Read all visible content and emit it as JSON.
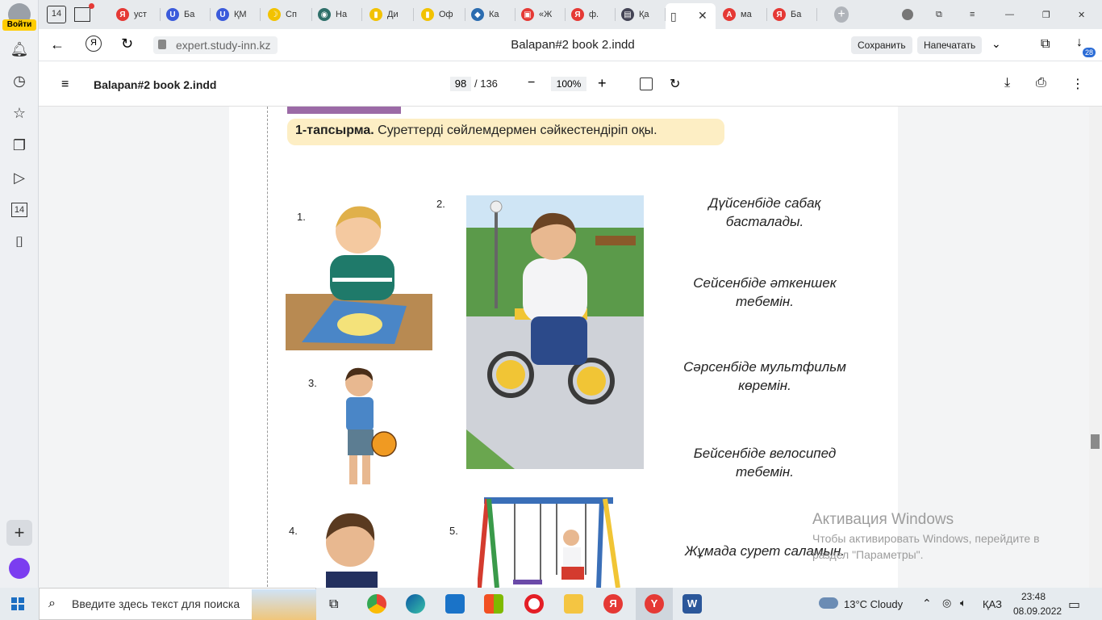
{
  "sidebar": {
    "login_label": "Войти",
    "badge_number": "14"
  },
  "tabs": [
    {
      "label": "уст",
      "color": "#e53935",
      "glyph": "Я"
    },
    {
      "label": "Ба",
      "color": "#3b5bdb",
      "glyph": "U"
    },
    {
      "label": "ҚМ",
      "color": "#3b5bdb",
      "glyph": "U"
    },
    {
      "label": "Сп",
      "color": "#f2c200",
      "glyph": "☽"
    },
    {
      "label": "На",
      "color": "#2f6f6a",
      "glyph": "◉"
    },
    {
      "label": "Ди",
      "color": "#f2c200",
      "glyph": "▮"
    },
    {
      "label": "Оф",
      "color": "#f2c200",
      "glyph": "▮"
    },
    {
      "label": "Ка",
      "color": "#2b6cb0",
      "glyph": "◆"
    },
    {
      "label": "«Ж",
      "color": "#e53935",
      "glyph": "▣"
    },
    {
      "label": "ф.",
      "color": "#e53935",
      "glyph": "Я"
    },
    {
      "label": "Қа",
      "color": "#445",
      "glyph": "▤"
    },
    {
      "label": "",
      "color": "#666",
      "glyph": "▯"
    },
    {
      "label": "ма",
      "color": "#e53935",
      "glyph": "A"
    },
    {
      "label": "Ба",
      "color": "#e53935",
      "glyph": "Я"
    }
  ],
  "address": {
    "url": "expert.study-inn.kz",
    "page_title": "Balapan#2 book 2.indd",
    "save_label": "Сохранить",
    "print_label": "Напечатать",
    "downloads_count": "28"
  },
  "pdf": {
    "title": "Balapan#2 book 2.indd",
    "page_current": "98",
    "page_total": "/ 136",
    "zoom": "100%"
  },
  "page": {
    "task_label": "1-тапсырма.",
    "task_text": "Суреттерді сөйлемдермен сәйкестендіріп оқы.",
    "numbers": [
      "1.",
      "2.",
      "3.",
      "4.",
      "5."
    ],
    "sentences": [
      "Дүйсенбіде сабақ басталады.",
      "Сейсенбіде әткеншек тебемін.",
      "Сәрсенбіде мультфильм көремін.",
      "Бейсенбіде велосипед тебемін.",
      "Жұмада сурет саламын."
    ]
  },
  "watermark": {
    "title": "Активация Windows",
    "text": "Чтобы активировать Windows, перейдите в раздел \"Параметры\"."
  },
  "taskbar": {
    "search_placeholder": "Введите здесь текст для поиска",
    "weather": "13°C  Cloudy",
    "language": "ҚАЗ",
    "time": "23:48",
    "date": "08.09.2022"
  }
}
